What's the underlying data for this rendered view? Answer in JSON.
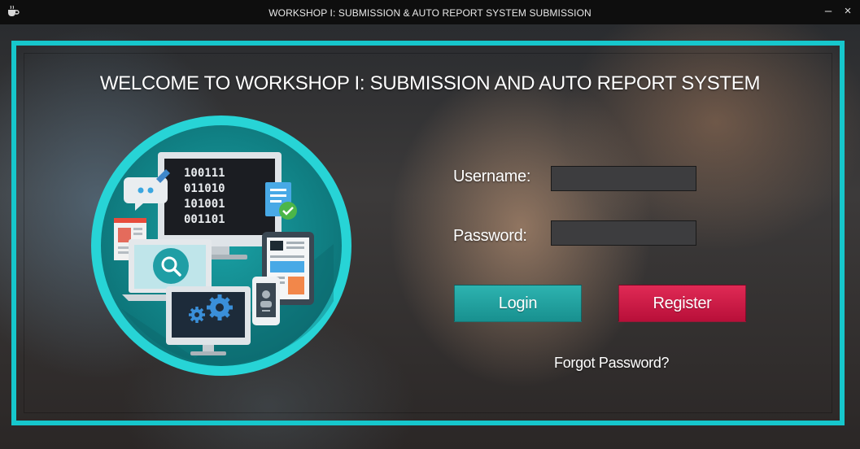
{
  "window": {
    "title": "WORKSHOP I: SUBMISSION & AUTO REPORT SYSTEM SUBMISSION",
    "minimize_glyph": "–",
    "close_glyph": "×",
    "app_icon": "coffee-cup-icon"
  },
  "welcome": {
    "heading": "WELCOME TO WORKSHOP I: SUBMISSION AND AUTO REPORT SYSTEM"
  },
  "illustration": {
    "binary_rows": [
      "100111",
      "011010",
      "101001",
      "001101"
    ],
    "icons": [
      "chat-bubble-icon",
      "document-check-icon",
      "magnifier-icon",
      "gears-icon",
      "tablet-icon",
      "phone-icon"
    ]
  },
  "form": {
    "username_label": "Username:",
    "username_value": "",
    "password_label": "Password:",
    "password_value": "",
    "login_label": "Login",
    "register_label": "Register",
    "forgot_label": "Forgot Password?"
  },
  "colors": {
    "accent": "#16c7cc",
    "login": "#21a2a0",
    "register": "#d01d47"
  }
}
